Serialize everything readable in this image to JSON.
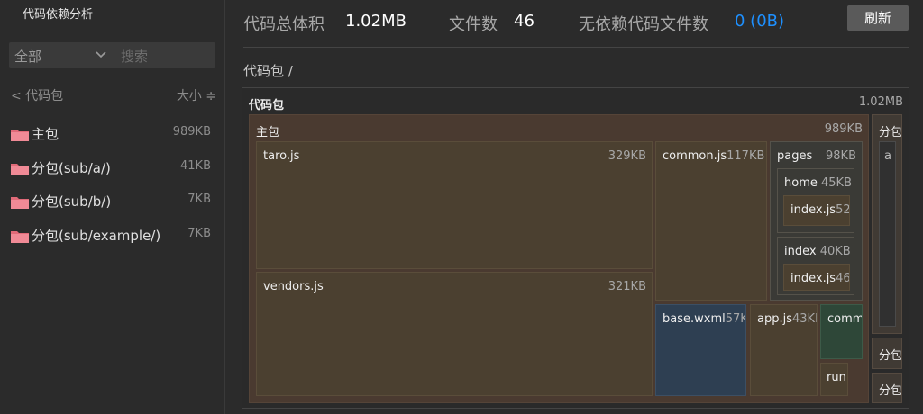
{
  "sidebar": {
    "title": "代码依赖分析",
    "filter": "全部",
    "search_placeholder": "搜索",
    "back_label": "< 代码包",
    "sort_label": "大小 ≑",
    "packages": [
      {
        "name": "主包",
        "size": "989KB"
      },
      {
        "name": "分包(sub/a/)",
        "size": "41KB"
      },
      {
        "name": "分包(sub/b/)",
        "size": "7KB"
      },
      {
        "name": "分包(sub/example/)",
        "size": "7KB"
      }
    ]
  },
  "stats": {
    "total_label": "代码总体积",
    "total_value": "1.02MB",
    "files_label": "文件数",
    "files_value": "46",
    "nodep_label": "无依赖代码文件数",
    "nodep_value": "0 (0B)"
  },
  "refresh_label": "刷新",
  "breadcrumb": "代码包 /",
  "treemap": {
    "root": {
      "name": "代码包",
      "size": "1.02MB"
    },
    "main": {
      "name": "主包",
      "size": "989KB"
    },
    "taro": {
      "name": "taro.js",
      "size": "329KB"
    },
    "vendors": {
      "name": "vendors.js",
      "size": "321KB"
    },
    "common": {
      "name": "common.js",
      "size": "117KB"
    },
    "pages": {
      "name": "pages",
      "size": "98KB"
    },
    "home": {
      "name": "home",
      "size": "45KB"
    },
    "home_index": {
      "name": "index.js",
      "size": "52"
    },
    "index": {
      "name": "index",
      "size": "40KB"
    },
    "index_index": {
      "name": "index.js",
      "size": "46"
    },
    "base": {
      "name": "base.wxml",
      "size": "57K"
    },
    "app": {
      "name": "app.js",
      "size": "43KE"
    },
    "comm": {
      "name": "comm"
    },
    "run": {
      "name": "run"
    },
    "sub1": {
      "name": "分包"
    },
    "sub1_child": {
      "name": "a"
    },
    "sub2": {
      "name": "分包"
    },
    "sub3": {
      "name": "分包"
    }
  },
  "colors": {
    "accent": "#1e90ff",
    "background": "#2b2b2b",
    "package_fill": "#4a3a30",
    "file_fill": "#4b4030"
  }
}
